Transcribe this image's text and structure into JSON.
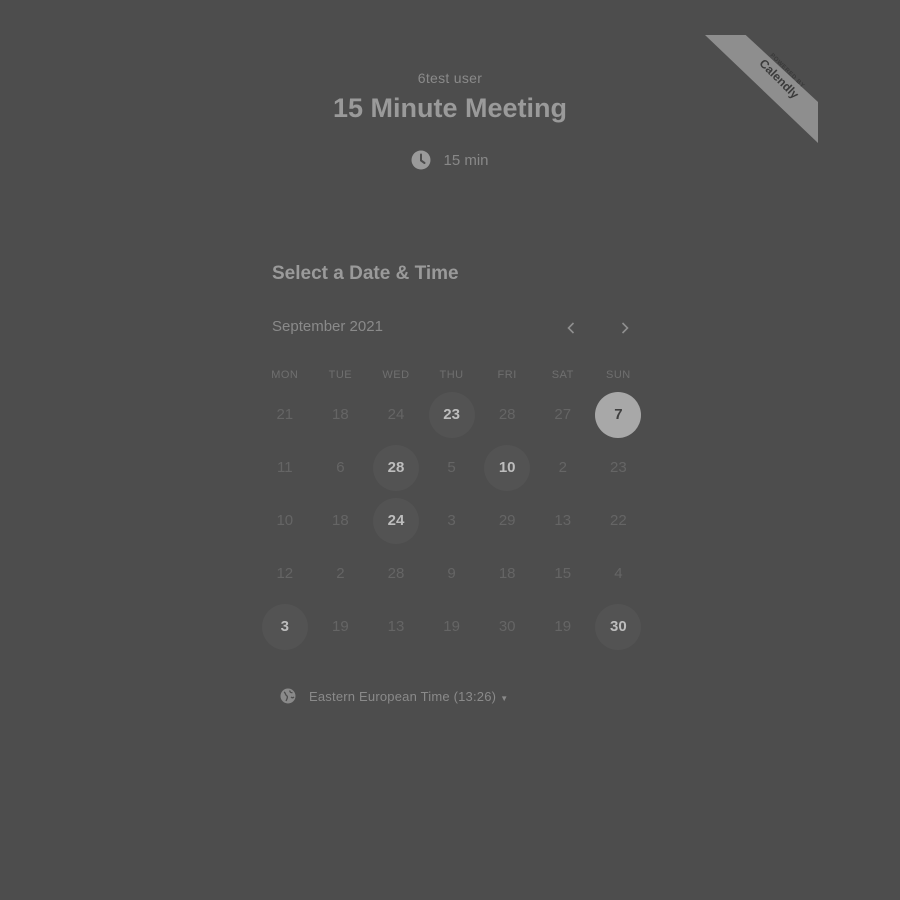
{
  "ribbon": {
    "small": "POWERED BY",
    "brand": "Calendly"
  },
  "header": {
    "owner": "6test user",
    "title": "15 Minute Meeting",
    "duration": "15 min"
  },
  "calendar": {
    "section_title": "Select a Date & Time",
    "month": "September 2021",
    "weekdays": [
      "MON",
      "TUE",
      "WED",
      "THU",
      "FRI",
      "SAT",
      "SUN"
    ],
    "weeks": [
      [
        {
          "d": "21",
          "s": "unavailable"
        },
        {
          "d": "18",
          "s": "unavailable"
        },
        {
          "d": "24",
          "s": "unavailable"
        },
        {
          "d": "23",
          "s": "available"
        },
        {
          "d": "28",
          "s": "unavailable"
        },
        {
          "d": "27",
          "s": "unavailable"
        },
        {
          "d": "7",
          "s": "selected"
        }
      ],
      [
        {
          "d": "11",
          "s": "unavailable"
        },
        {
          "d": "6",
          "s": "unavailable"
        },
        {
          "d": "28",
          "s": "available"
        },
        {
          "d": "5",
          "s": "unavailable"
        },
        {
          "d": "10",
          "s": "available"
        },
        {
          "d": "2",
          "s": "unavailable"
        },
        {
          "d": "23",
          "s": "unavailable"
        }
      ],
      [
        {
          "d": "10",
          "s": "unavailable"
        },
        {
          "d": "18",
          "s": "unavailable"
        },
        {
          "d": "24",
          "s": "available"
        },
        {
          "d": "3",
          "s": "unavailable"
        },
        {
          "d": "29",
          "s": "unavailable"
        },
        {
          "d": "13",
          "s": "unavailable"
        },
        {
          "d": "22",
          "s": "unavailable"
        }
      ],
      [
        {
          "d": "12",
          "s": "unavailable"
        },
        {
          "d": "2",
          "s": "unavailable"
        },
        {
          "d": "28",
          "s": "unavailable"
        },
        {
          "d": "9",
          "s": "unavailable"
        },
        {
          "d": "18",
          "s": "unavailable"
        },
        {
          "d": "15",
          "s": "unavailable"
        },
        {
          "d": "4",
          "s": "unavailable"
        }
      ],
      [
        {
          "d": "3",
          "s": "available"
        },
        {
          "d": "19",
          "s": "unavailable"
        },
        {
          "d": "13",
          "s": "unavailable"
        },
        {
          "d": "19",
          "s": "unavailable"
        },
        {
          "d": "30",
          "s": "unavailable"
        },
        {
          "d": "19",
          "s": "unavailable"
        },
        {
          "d": "30",
          "s": "available"
        }
      ]
    ]
  },
  "timezone": {
    "label": "Eastern European Time (13:26)"
  },
  "icons": {
    "clock": "clock-icon",
    "globe": "globe-icon",
    "prev": "chevron-left-icon",
    "next": "chevron-right-icon",
    "caret": "caret-down-icon"
  }
}
